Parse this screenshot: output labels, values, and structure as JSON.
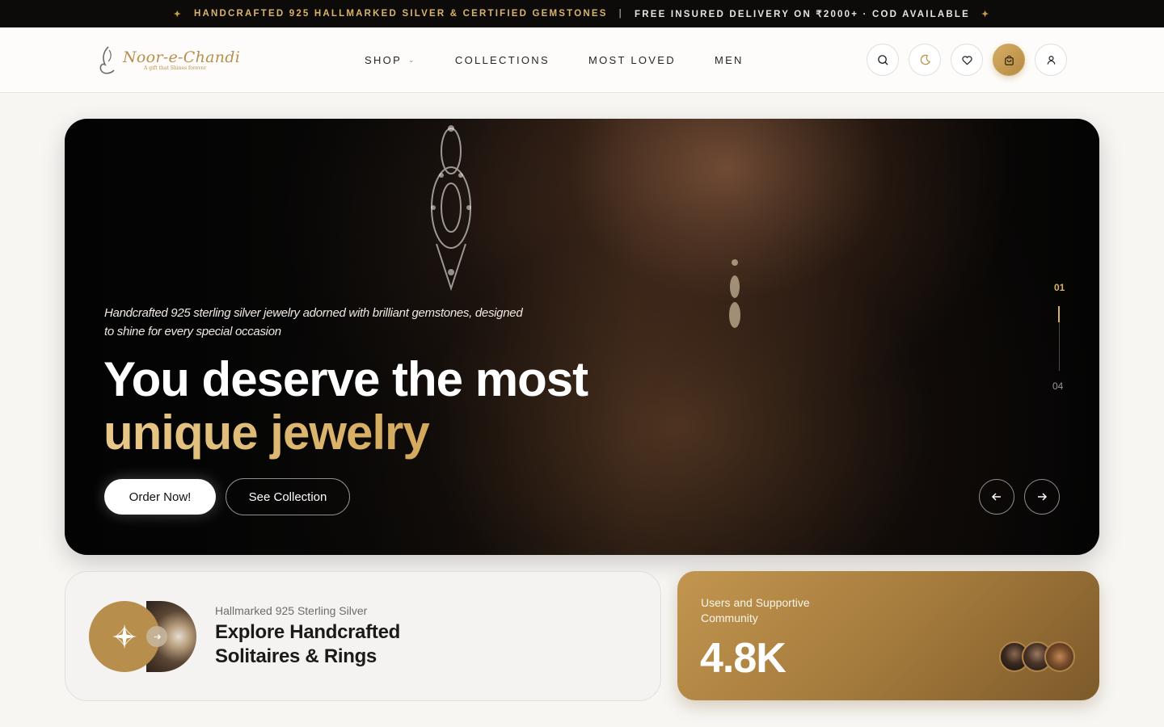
{
  "announcement": {
    "left": "HANDCRAFTED 925 HALLMARKED SILVER & CERTIFIED GEMSTONES",
    "separator": "|",
    "right": "FREE INSURED DELIVERY ON ₹2000+ · COD AVAILABLE",
    "star": "✦"
  },
  "header": {
    "logo_name": "Noor-e-Chandi",
    "logo_tagline": "A gift that Shines forever",
    "nav": [
      {
        "label": "SHOP"
      },
      {
        "label": "COLLECTIONS"
      },
      {
        "label": "MOST LOVED"
      },
      {
        "label": "MEN"
      }
    ],
    "icons": [
      "search-icon",
      "moon-icon",
      "heart-icon",
      "bag-icon",
      "user-icon"
    ]
  },
  "hero": {
    "subtitle": "Handcrafted 925 sterling silver jewelry adorned with brilliant gemstones, designed to shine for every special occasion",
    "title_line1": "You deserve the most",
    "title_line2": "unique jewelry",
    "primary_button": "Order Now!",
    "secondary_button": "See Collection",
    "slide_current": "01",
    "slide_total": "04",
    "slide_progress": 0.25
  },
  "explore_card": {
    "small": "Hallmarked 925 Sterling Silver",
    "title_line1": "Explore Handcrafted",
    "title_line2": "Solitaires & Rings"
  },
  "community_card": {
    "label": "Users and Supportive Community",
    "value": "4.8K"
  },
  "colors": {
    "accent_gold": "#c89a45",
    "topbar_bg": "#0c0b0a",
    "community_bg": "#a57b3d"
  }
}
